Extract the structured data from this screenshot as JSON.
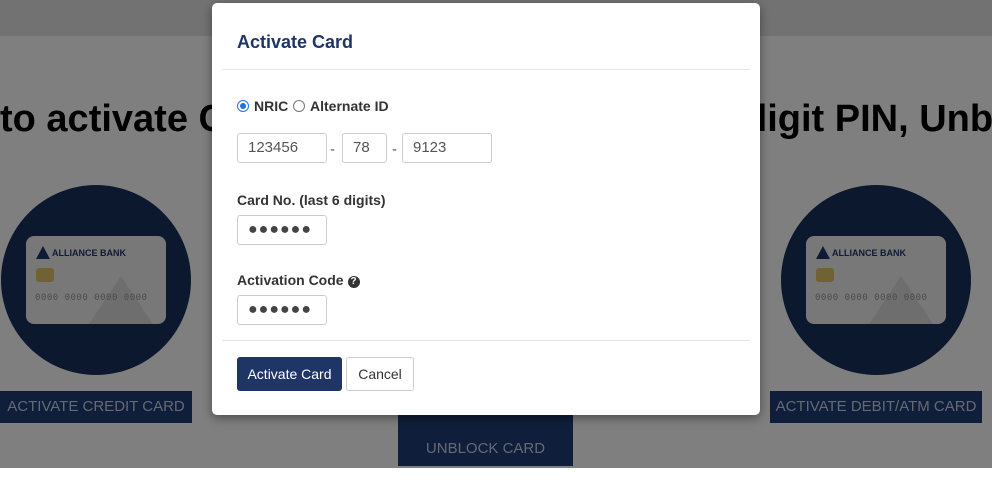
{
  "background": {
    "headline_left": "to activate C",
    "headline_right": "digit PIN, Unb",
    "card_bank_name": "ALLIANCE BANK",
    "card_number_mask": "0000 0000 0000 0000",
    "buttons": {
      "activate_credit": "ACTIVATE CREDIT CARD",
      "unblock": "UNBLOCK CARD",
      "activate_debit": "ACTIVATE DEBIT/ATM CARD"
    },
    "colors": {
      "navy": "#17305c",
      "button": "#1f3c74"
    }
  },
  "modal": {
    "title": "Activate Card",
    "id_type": {
      "options": [
        "NRIC",
        "Alternate ID"
      ],
      "selected": "NRIC"
    },
    "nric": {
      "part1": "123456",
      "part2": "78",
      "part3": "9123",
      "separator": "-"
    },
    "card_no": {
      "label": "Card No. (last 6 digits)",
      "value": "●●●●●●"
    },
    "activation_code": {
      "label": "Activation Code",
      "help_icon": "question-circle-icon",
      "value": "●●●●●●"
    },
    "buttons": {
      "primary": "Activate Card",
      "cancel": "Cancel"
    },
    "colors": {
      "title": "#1e3566",
      "primary_button": "#1e3566",
      "radio_selected": "#1a73e8"
    }
  }
}
